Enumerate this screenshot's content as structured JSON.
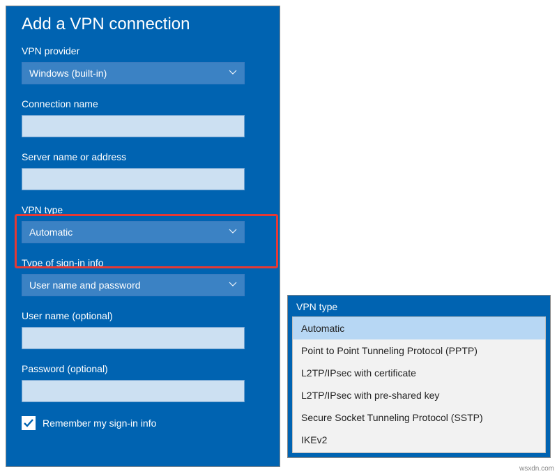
{
  "title": "Add a VPN connection",
  "fields": {
    "provider": {
      "label": "VPN provider",
      "value": "Windows (built-in)"
    },
    "connection_name": {
      "label": "Connection name",
      "value": ""
    },
    "server": {
      "label": "Server name or address",
      "value": ""
    },
    "vpn_type": {
      "label": "VPN type",
      "value": "Automatic"
    },
    "signin_type": {
      "label": "Type of sign-in info",
      "value": "User name and password"
    },
    "username": {
      "label": "User name (optional)",
      "value": ""
    },
    "password": {
      "label": "Password (optional)",
      "value": ""
    }
  },
  "remember": {
    "label": "Remember my sign-in info",
    "checked": true
  },
  "dropdown": {
    "title": "VPN type",
    "items": [
      "Automatic",
      "Point to Point Tunneling Protocol (PPTP)",
      "L2TP/IPsec with certificate",
      "L2TP/IPsec with pre-shared key",
      "Secure Socket Tunneling Protocol (SSTP)",
      "IKEv2"
    ],
    "selected_index": 0
  },
  "watermark": "wsxdn.com"
}
